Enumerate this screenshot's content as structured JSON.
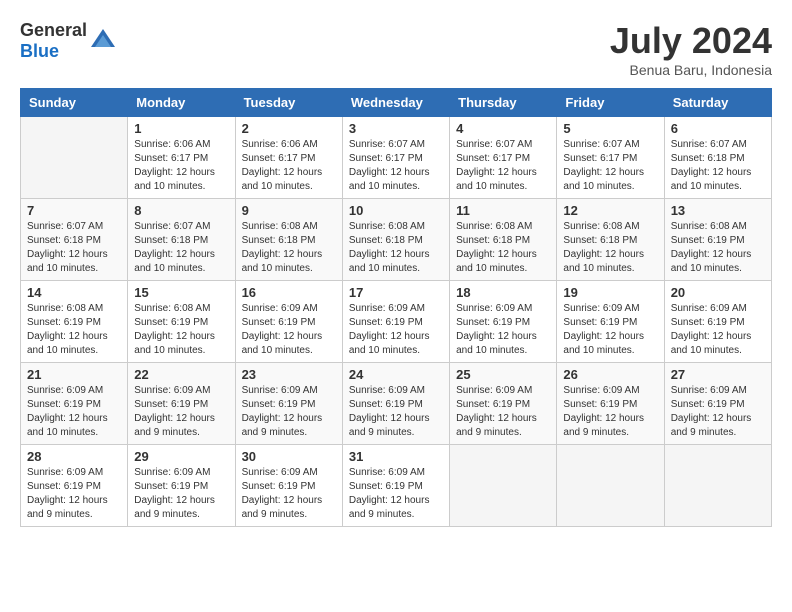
{
  "header": {
    "logo_general": "General",
    "logo_blue": "Blue",
    "month_year": "July 2024",
    "location": "Benua Baru, Indonesia"
  },
  "weekdays": [
    "Sunday",
    "Monday",
    "Tuesday",
    "Wednesday",
    "Thursday",
    "Friday",
    "Saturday"
  ],
  "weeks": [
    [
      {
        "day": "",
        "sunrise": "",
        "sunset": "",
        "daylight": ""
      },
      {
        "day": "1",
        "sunrise": "Sunrise: 6:06 AM",
        "sunset": "Sunset: 6:17 PM",
        "daylight": "Daylight: 12 hours and 10 minutes."
      },
      {
        "day": "2",
        "sunrise": "Sunrise: 6:06 AM",
        "sunset": "Sunset: 6:17 PM",
        "daylight": "Daylight: 12 hours and 10 minutes."
      },
      {
        "day": "3",
        "sunrise": "Sunrise: 6:07 AM",
        "sunset": "Sunset: 6:17 PM",
        "daylight": "Daylight: 12 hours and 10 minutes."
      },
      {
        "day": "4",
        "sunrise": "Sunrise: 6:07 AM",
        "sunset": "Sunset: 6:17 PM",
        "daylight": "Daylight: 12 hours and 10 minutes."
      },
      {
        "day": "5",
        "sunrise": "Sunrise: 6:07 AM",
        "sunset": "Sunset: 6:17 PM",
        "daylight": "Daylight: 12 hours and 10 minutes."
      },
      {
        "day": "6",
        "sunrise": "Sunrise: 6:07 AM",
        "sunset": "Sunset: 6:18 PM",
        "daylight": "Daylight: 12 hours and 10 minutes."
      }
    ],
    [
      {
        "day": "7",
        "sunrise": "Sunrise: 6:07 AM",
        "sunset": "Sunset: 6:18 PM",
        "daylight": "Daylight: 12 hours and 10 minutes."
      },
      {
        "day": "8",
        "sunrise": "Sunrise: 6:07 AM",
        "sunset": "Sunset: 6:18 PM",
        "daylight": "Daylight: 12 hours and 10 minutes."
      },
      {
        "day": "9",
        "sunrise": "Sunrise: 6:08 AM",
        "sunset": "Sunset: 6:18 PM",
        "daylight": "Daylight: 12 hours and 10 minutes."
      },
      {
        "day": "10",
        "sunrise": "Sunrise: 6:08 AM",
        "sunset": "Sunset: 6:18 PM",
        "daylight": "Daylight: 12 hours and 10 minutes."
      },
      {
        "day": "11",
        "sunrise": "Sunrise: 6:08 AM",
        "sunset": "Sunset: 6:18 PM",
        "daylight": "Daylight: 12 hours and 10 minutes."
      },
      {
        "day": "12",
        "sunrise": "Sunrise: 6:08 AM",
        "sunset": "Sunset: 6:18 PM",
        "daylight": "Daylight: 12 hours and 10 minutes."
      },
      {
        "day": "13",
        "sunrise": "Sunrise: 6:08 AM",
        "sunset": "Sunset: 6:19 PM",
        "daylight": "Daylight: 12 hours and 10 minutes."
      }
    ],
    [
      {
        "day": "14",
        "sunrise": "Sunrise: 6:08 AM",
        "sunset": "Sunset: 6:19 PM",
        "daylight": "Daylight: 12 hours and 10 minutes."
      },
      {
        "day": "15",
        "sunrise": "Sunrise: 6:08 AM",
        "sunset": "Sunset: 6:19 PM",
        "daylight": "Daylight: 12 hours and 10 minutes."
      },
      {
        "day": "16",
        "sunrise": "Sunrise: 6:09 AM",
        "sunset": "Sunset: 6:19 PM",
        "daylight": "Daylight: 12 hours and 10 minutes."
      },
      {
        "day": "17",
        "sunrise": "Sunrise: 6:09 AM",
        "sunset": "Sunset: 6:19 PM",
        "daylight": "Daylight: 12 hours and 10 minutes."
      },
      {
        "day": "18",
        "sunrise": "Sunrise: 6:09 AM",
        "sunset": "Sunset: 6:19 PM",
        "daylight": "Daylight: 12 hours and 10 minutes."
      },
      {
        "day": "19",
        "sunrise": "Sunrise: 6:09 AM",
        "sunset": "Sunset: 6:19 PM",
        "daylight": "Daylight: 12 hours and 10 minutes."
      },
      {
        "day": "20",
        "sunrise": "Sunrise: 6:09 AM",
        "sunset": "Sunset: 6:19 PM",
        "daylight": "Daylight: 12 hours and 10 minutes."
      }
    ],
    [
      {
        "day": "21",
        "sunrise": "Sunrise: 6:09 AM",
        "sunset": "Sunset: 6:19 PM",
        "daylight": "Daylight: 12 hours and 10 minutes."
      },
      {
        "day": "22",
        "sunrise": "Sunrise: 6:09 AM",
        "sunset": "Sunset: 6:19 PM",
        "daylight": "Daylight: 12 hours and 9 minutes."
      },
      {
        "day": "23",
        "sunrise": "Sunrise: 6:09 AM",
        "sunset": "Sunset: 6:19 PM",
        "daylight": "Daylight: 12 hours and 9 minutes."
      },
      {
        "day": "24",
        "sunrise": "Sunrise: 6:09 AM",
        "sunset": "Sunset: 6:19 PM",
        "daylight": "Daylight: 12 hours and 9 minutes."
      },
      {
        "day": "25",
        "sunrise": "Sunrise: 6:09 AM",
        "sunset": "Sunset: 6:19 PM",
        "daylight": "Daylight: 12 hours and 9 minutes."
      },
      {
        "day": "26",
        "sunrise": "Sunrise: 6:09 AM",
        "sunset": "Sunset: 6:19 PM",
        "daylight": "Daylight: 12 hours and 9 minutes."
      },
      {
        "day": "27",
        "sunrise": "Sunrise: 6:09 AM",
        "sunset": "Sunset: 6:19 PM",
        "daylight": "Daylight: 12 hours and 9 minutes."
      }
    ],
    [
      {
        "day": "28",
        "sunrise": "Sunrise: 6:09 AM",
        "sunset": "Sunset: 6:19 PM",
        "daylight": "Daylight: 12 hours and 9 minutes."
      },
      {
        "day": "29",
        "sunrise": "Sunrise: 6:09 AM",
        "sunset": "Sunset: 6:19 PM",
        "daylight": "Daylight: 12 hours and 9 minutes."
      },
      {
        "day": "30",
        "sunrise": "Sunrise: 6:09 AM",
        "sunset": "Sunset: 6:19 PM",
        "daylight": "Daylight: 12 hours and 9 minutes."
      },
      {
        "day": "31",
        "sunrise": "Sunrise: 6:09 AM",
        "sunset": "Sunset: 6:19 PM",
        "daylight": "Daylight: 12 hours and 9 minutes."
      },
      {
        "day": "",
        "sunrise": "",
        "sunset": "",
        "daylight": ""
      },
      {
        "day": "",
        "sunrise": "",
        "sunset": "",
        "daylight": ""
      },
      {
        "day": "",
        "sunrise": "",
        "sunset": "",
        "daylight": ""
      }
    ]
  ]
}
